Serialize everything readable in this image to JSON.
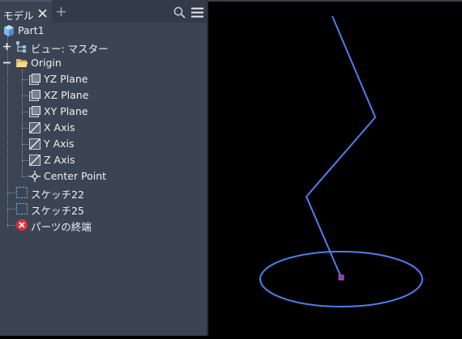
{
  "browser": {
    "tab_label": "モデル",
    "tree": {
      "part": "Part1",
      "view": "ビュー: マスター",
      "origin": "Origin",
      "origin_items": [
        "YZ Plane",
        "XZ Plane",
        "XY Plane",
        "X Axis",
        "Y Axis",
        "Z Axis",
        "Center Point"
      ],
      "sketch1": "スケッチ22",
      "sketch2": "スケッチ25",
      "end_of_part": "パーツの終端"
    }
  },
  "colors": {
    "sketch_line": "#4d7ff0",
    "panel_bg": "#3b4453",
    "end_marker": "#e0303a",
    "point": "#9b2fb0"
  },
  "icons": {
    "tab_close": "close-icon",
    "tab_add": "plus-icon",
    "search": "search-icon",
    "menu": "hamburger-menu-icon"
  }
}
